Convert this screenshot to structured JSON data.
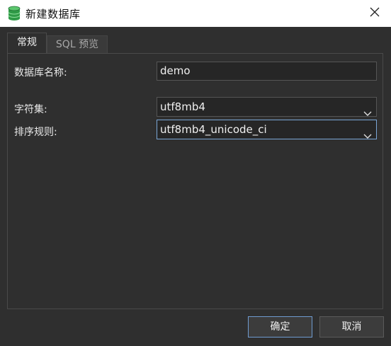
{
  "window": {
    "title": "新建数据库",
    "icon": "database-icon",
    "close_icon": "close-icon"
  },
  "tabs": [
    {
      "label": "常规",
      "active": true
    },
    {
      "label": "SQL 预览",
      "active": false
    }
  ],
  "form": {
    "db_name_label": "数据库名称:",
    "db_name_value": "demo",
    "charset_label": "字符集:",
    "charset_value": "utf8mb4",
    "collation_label": "排序规则:",
    "collation_value": "utf8mb4_unicode_ci"
  },
  "buttons": {
    "ok_label": "确定",
    "cancel_label": "取消"
  },
  "colors": {
    "background": "#2f2f2f",
    "titlebar": "#ffffff",
    "focus_border": "#7aa6d6",
    "icon_green": "#3aa655"
  }
}
